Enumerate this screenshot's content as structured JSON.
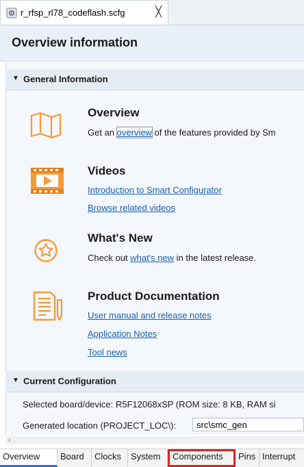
{
  "editor_tab": {
    "title": "r_rfsp_rl78_codeflash.scfg",
    "close_glyph": "╳",
    "icon": "settings-file-icon"
  },
  "header": {
    "title": "Overview information"
  },
  "general_section": {
    "title": "General Information",
    "items": [
      {
        "icon": "map-icon",
        "title": "Overview",
        "text_before": "Get an ",
        "link": "overview",
        "text_after": " of the features provided by Sm"
      },
      {
        "icon": "video-icon",
        "title": "Videos",
        "links": [
          "Introduction to Smart Configurator",
          "Browse related videos"
        ]
      },
      {
        "icon": "star-icon",
        "title": "What's New",
        "text_before": "Check out ",
        "link": "what's new",
        "text_after": " in the latest release."
      },
      {
        "icon": "document-icon",
        "title": "Product Documentation",
        "links": [
          "User manual and release notes",
          "Application Notes",
          "Tool news"
        ]
      }
    ]
  },
  "config_section": {
    "title": "Current Configuration",
    "selected_board": "Selected board/device: R5F12068xSP (ROM size: 8 KB, RAM si",
    "generated_location_label": "Generated location (PROJECT_LOC\\):",
    "generated_location_value": "src\\smc_gen"
  },
  "bottom_tabs": [
    {
      "label": "Overview",
      "active": true
    },
    {
      "label": "Board"
    },
    {
      "label": "Clocks"
    },
    {
      "label": "System"
    },
    {
      "label": "Components",
      "highlighted": true
    },
    {
      "label": "Pins"
    },
    {
      "label": "Interrupt"
    }
  ],
  "colors": {
    "accent_orange": "#f59a3a",
    "link_blue": "#1b5fae",
    "highlight_red": "#e02020",
    "active_tab_blue": "#2b73c9"
  }
}
